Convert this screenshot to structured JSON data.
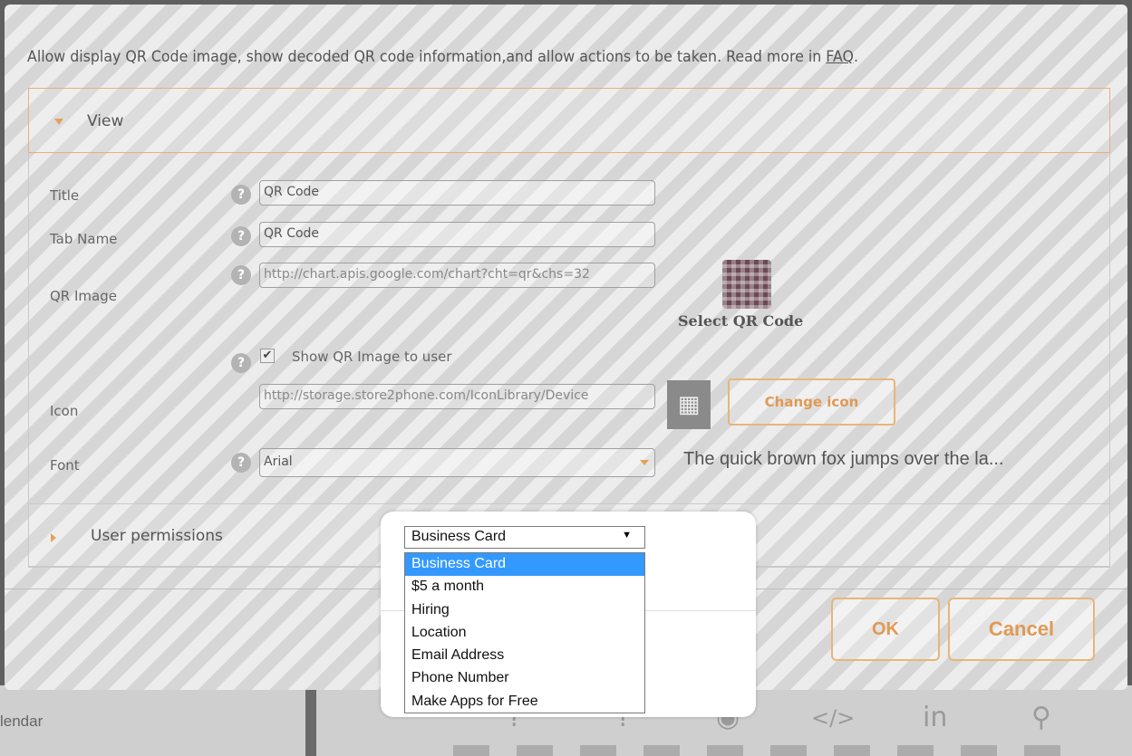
{
  "background": {
    "calendar_label": "lendar",
    "icons": [
      "?",
      "?",
      "</>",
      "in",
      "map-pin-icon"
    ]
  },
  "dialog": {
    "description": "Allow display QR Code image, show decoded QR code information,and allow actions to be taken. Read more in",
    "faq_link": "FAQ",
    "faq_suffix": ".",
    "view_section": {
      "label": "View",
      "fields": {
        "title": {
          "label": "Title",
          "value": "QR Code"
        },
        "tab_name": {
          "label": "Tab Name",
          "value": "QR Code"
        },
        "qr_image": {
          "label": "QR Image",
          "value": "http://chart.apis.google.com/chart?cht=qr&chs=32"
        },
        "select_qr_label": "Select QR Code",
        "show_qr": {
          "label": "Show QR Image to user",
          "checked": true
        },
        "icon": {
          "label": "Icon",
          "value": "http://storage.store2phone.com/IconLibrary/Device"
        },
        "change_icon_label": "Change icon",
        "font": {
          "label": "Font",
          "value": "Arial"
        },
        "font_preview": "The quick brown fox jumps over the la..."
      }
    },
    "permissions_section": {
      "label": "User permissions"
    },
    "buttons": {
      "ok": "OK",
      "cancel": "Cancel",
      "cancel_partial": "ncel"
    }
  },
  "popup": {
    "dropdown": {
      "selected": "Business Card",
      "options": [
        "Business Card",
        "$5 a month",
        "Hiring",
        "Location",
        "Email Address",
        "Phone Number",
        "Make Apps for Free"
      ],
      "highlighted_index": 0
    }
  },
  "colors": {
    "accent": "#e09a55",
    "accent_border": "#e8b57a",
    "highlight": "#3399ff"
  }
}
